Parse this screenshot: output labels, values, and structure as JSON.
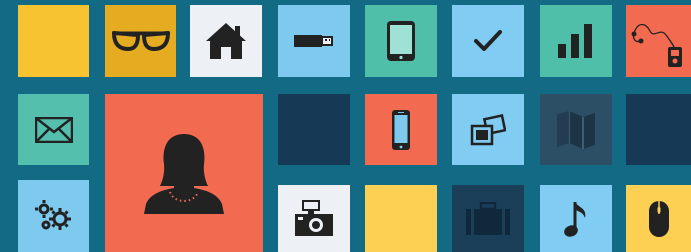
{
  "background": "#136a85",
  "tiles": [
    {
      "name": "tile-yellow-1",
      "color": "#f7c331",
      "icon": null
    },
    {
      "name": "tile-glasses",
      "color": "#e5ac22",
      "icon": "glasses-icon"
    },
    {
      "name": "tile-home",
      "color": "#edf1f5",
      "icon": "house-icon"
    },
    {
      "name": "tile-usb",
      "color": "#7ecaef",
      "icon": "usb-drive-icon"
    },
    {
      "name": "tile-tablet",
      "color": "#4fbfaa",
      "icon": "tablet-icon"
    },
    {
      "name": "tile-check",
      "color": "#80ccf2",
      "icon": "checkmark-icon"
    },
    {
      "name": "tile-signal",
      "color": "#4fbfaa",
      "icon": "signal-bars-icon"
    },
    {
      "name": "tile-mp3",
      "color": "#f26a4f",
      "icon": "mp3-player-icon"
    },
    {
      "name": "tile-mail",
      "color": "#55bfad",
      "icon": "envelope-icon"
    },
    {
      "name": "tile-user",
      "color": "#f26a4f",
      "icon": "user-female-icon"
    },
    {
      "name": "tile-dark-1",
      "color": "#163a56",
      "icon": null
    },
    {
      "name": "tile-phone",
      "color": "#f26a4f",
      "icon": "smartphone-icon"
    },
    {
      "name": "tile-photos",
      "color": "#80ccf2",
      "icon": "photos-icon"
    },
    {
      "name": "tile-map",
      "color": "#2c4f66",
      "icon": "map-icon"
    },
    {
      "name": "tile-dark-2",
      "color": "#163a56",
      "icon": null
    },
    {
      "name": "tile-settings",
      "color": "#7ecaef",
      "icon": "gears-icon"
    },
    {
      "name": "tile-camera",
      "color": "#edf1f5",
      "icon": "camera-icon"
    },
    {
      "name": "tile-yellow-2",
      "color": "#fdcf53",
      "icon": null
    },
    {
      "name": "tile-briefcase",
      "color": "#1b3f58",
      "icon": "briefcase-icon"
    },
    {
      "name": "tile-music",
      "color": "#80ccf2",
      "icon": "music-note-icon"
    },
    {
      "name": "tile-mouse",
      "color": "#fdcf53",
      "icon": "computer-mouse-icon"
    }
  ]
}
